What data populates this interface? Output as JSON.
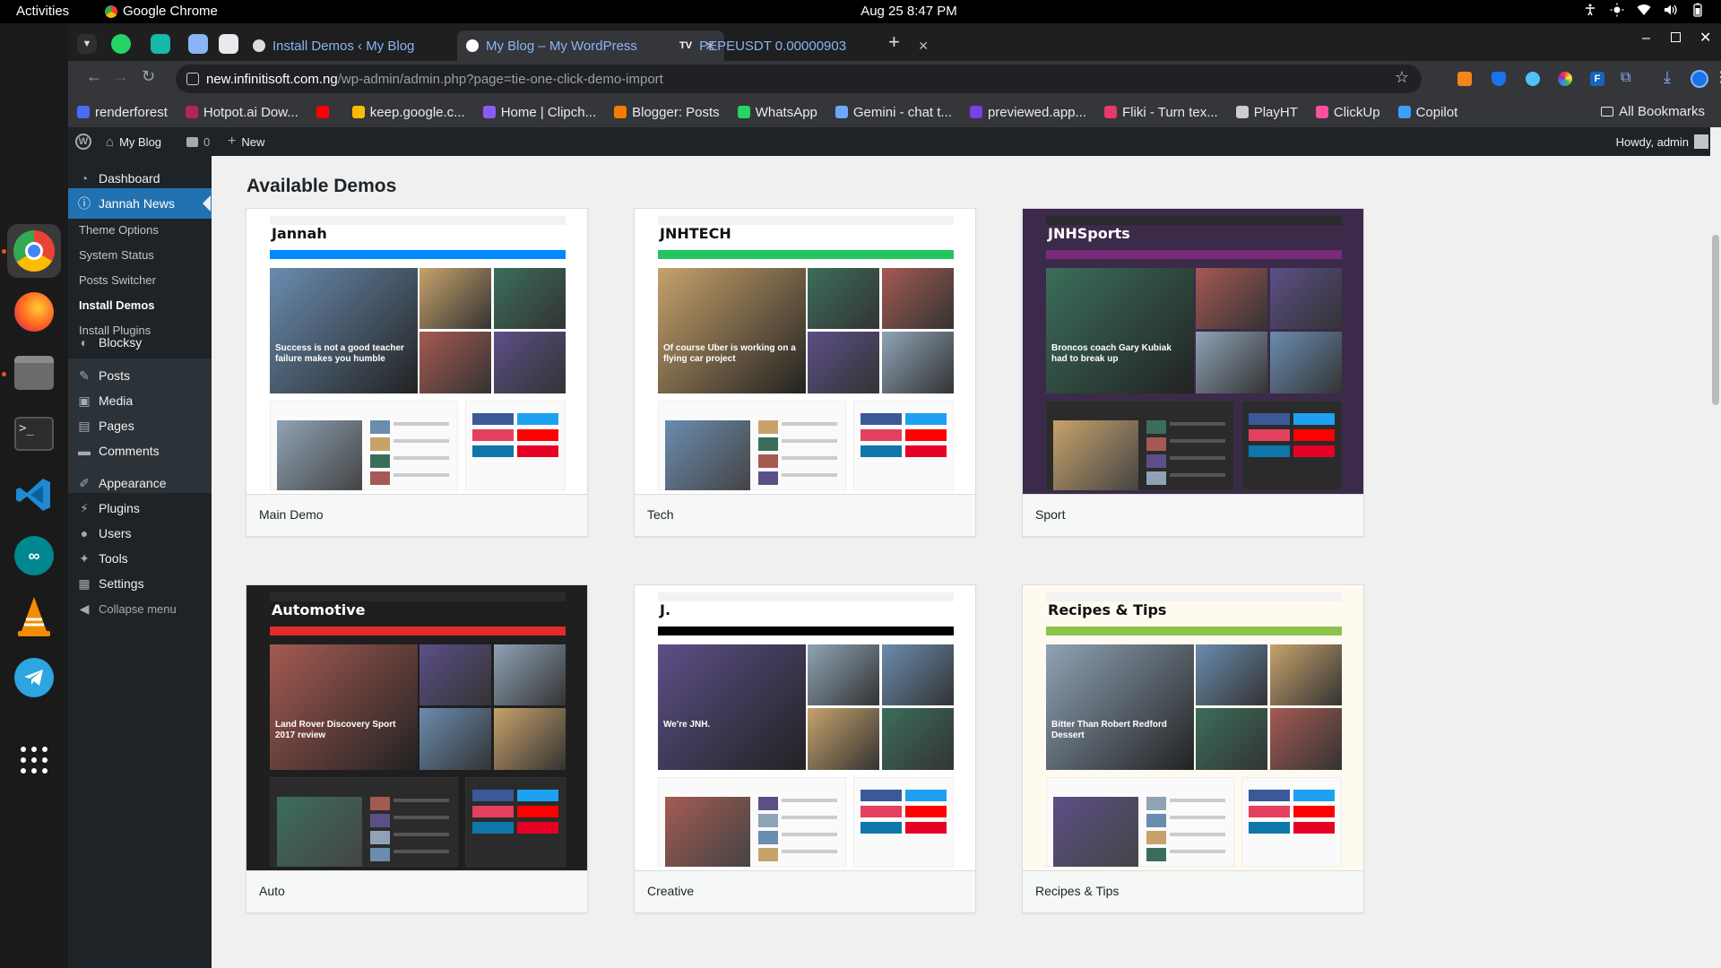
{
  "system": {
    "activities": "Activities",
    "app_name": "Google Chrome",
    "clock": "Aug 25  8:47 PM"
  },
  "browser": {
    "tabs": [
      {
        "title": "Install Demos ‹ My Blog",
        "active": false
      },
      {
        "title": "My Blog – My WordPress",
        "active": true
      },
      {
        "title": "PEPEUSDT 0.00000903",
        "active": false
      }
    ],
    "url_host": "new.infinitisoft.com.ng",
    "url_path": "/wp-admin/admin.php?page=tie-one-click-demo-import",
    "bookmarks": [
      {
        "label": "renderforest",
        "color": "#4a6cf7"
      },
      {
        "label": "Hotpot.ai Dow...",
        "color": "#b2245c"
      },
      {
        "label": "",
        "color": "#ff0000"
      },
      {
        "label": "keep.google.c...",
        "color": "#fbbc04"
      },
      {
        "label": "Home | Clipch...",
        "color": "#8a5cf6"
      },
      {
        "label": "Blogger: Posts",
        "color": "#f57c00"
      },
      {
        "label": "WhatsApp",
        "color": "#25d366"
      },
      {
        "label": "Gemini - chat t...",
        "color": "#6ea8fe"
      },
      {
        "label": "previewed.app...",
        "color": "#7b3fe4"
      },
      {
        "label": "Fliki - Turn tex...",
        "color": "#e63a6b"
      },
      {
        "label": "PlayHT",
        "color": "#cccccc"
      },
      {
        "label": "ClickUp",
        "color": "#ff4fa0"
      },
      {
        "label": "Copilot",
        "color": "#3aa0ff"
      }
    ],
    "all_bookmarks": "All Bookmarks"
  },
  "adminbar": {
    "site_name": "My Blog",
    "comments_count": "0",
    "new_label": "New",
    "howdy": "Howdy, admin"
  },
  "menu": {
    "items": [
      {
        "label": "Dashboard",
        "icon": "dashboard-icon"
      },
      {
        "label": "Jannah News",
        "icon": "info-icon"
      },
      {
        "label": "Blocksy",
        "icon": "blocksy-icon"
      },
      {
        "label": "Posts",
        "icon": "pin-icon"
      },
      {
        "label": "Media",
        "icon": "media-icon"
      },
      {
        "label": "Pages",
        "icon": "pages-icon"
      },
      {
        "label": "Comments",
        "icon": "comments-icon"
      },
      {
        "label": "Appearance",
        "icon": "brush-icon"
      },
      {
        "label": "Plugins",
        "icon": "plugin-icon"
      },
      {
        "label": "Users",
        "icon": "users-icon"
      },
      {
        "label": "Tools",
        "icon": "tools-icon"
      },
      {
        "label": "Settings",
        "icon": "settings-icon"
      },
      {
        "label": "Collapse menu",
        "icon": "collapse-icon"
      }
    ],
    "submenu": [
      "Theme Options",
      "System Status",
      "Posts Switcher",
      "Install Demos",
      "Install Plugins"
    ]
  },
  "page": {
    "title": "Available Demos",
    "demos": [
      {
        "name": "Main Demo",
        "logo": "Jannah",
        "headline": "Success is not a good teacher failure makes you humble",
        "accent": "#0088ff",
        "bg": "#ffffff"
      },
      {
        "name": "Tech",
        "logo": "JNHTECH",
        "headline": "Of course Uber is working on a flying car project",
        "accent": "#22c55e",
        "bg": "#ffffff"
      },
      {
        "name": "Sport",
        "logo": "JNHSports",
        "headline": "Broncos coach Gary Kubiak had to break up",
        "accent": "#7a2a7a",
        "bg": "#3b2a4a"
      },
      {
        "name": "Auto",
        "logo": "Automotive",
        "headline": "Land Rover Discovery Sport 2017 review",
        "accent": "#e22b2b",
        "bg": "#1f1f1f"
      },
      {
        "name": "Creative",
        "logo": "J.",
        "headline": "We're JNH.",
        "accent": "#000000",
        "bg": "#ffffff"
      },
      {
        "name": "Recipes & Tips",
        "logo": "Recipes & Tips",
        "headline": "Bitter Than Robert Redford Dessert",
        "accent": "#8bc34a",
        "bg": "#fffaf0"
      }
    ]
  },
  "colors": {
    "wp_admin_dark": "#1d2327",
    "wp_blue": "#2271b1",
    "chrome_dark": "#35363a"
  }
}
